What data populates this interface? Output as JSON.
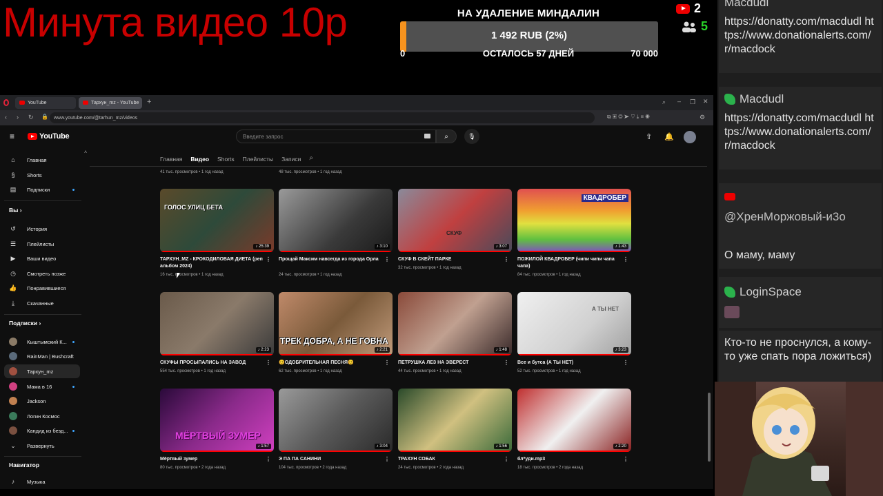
{
  "overlay": {
    "title": "Минута видео 10р",
    "goal": {
      "title": "НА УДАЛЕНИЕ МИНДАЛИН",
      "amount": "1 492 RUB (2%)",
      "progress": 0.02,
      "min": "0",
      "days_left": "ОСТАЛОСЬ 57 ДНЕЙ",
      "max": "70 000",
      "fill_color": "#f7931e"
    },
    "youtube_count": "2",
    "viewer_count": "5"
  },
  "chat": {
    "messages": [
      {
        "user": "Macdudl",
        "platform": "green-icon",
        "text": "https://donatty.com/macdudl https://www.donationalerts.com/r/macdock"
      },
      {
        "user": "Macdudl",
        "platform": "green-icon",
        "text": "https://donatty.com/macdudl https://www.donationalerts.com/r/macdock"
      },
      {
        "user": "@ХренМоржовый-и3о",
        "platform": "youtube-icon",
        "text": "О маму, маму"
      },
      {
        "user": "LoginSpace",
        "platform": "green-icon",
        "text": ""
      },
      {
        "user": "",
        "platform": "",
        "text": "Кто-то не проснулся, а кому-то уже спать пора ложиться)"
      }
    ]
  },
  "browser": {
    "tabs": [
      "YouTube",
      "Тархун_mz - YouTube"
    ],
    "url": "www.youtube.com/@tarhun_mz/videos"
  },
  "youtube": {
    "logo": "YouTube",
    "search_placeholder": "Введите запрос",
    "sidebar": {
      "main": [
        "Главная",
        "Shorts",
        "Подписки"
      ],
      "you_header": "Вы",
      "you": [
        "История",
        "Плейлисты",
        "Ваши видео",
        "Смотреть позже",
        "Понравившиеся",
        "Скачанные"
      ],
      "subs_header": "Подписки",
      "subs": [
        "Кыштымский К...",
        "RainMan | Bushcraft",
        "Тархун_mz",
        "Мама в 16",
        "Jackson",
        "Логин Космос",
        "Кандид из безд...",
        "Развернуть"
      ],
      "nav_header": "Навигатор",
      "nav": [
        "Музыка"
      ]
    },
    "channel_tabs": [
      "Главная",
      "Видео",
      "Shorts",
      "Плейлисты",
      "Записи"
    ],
    "top_row_meta": [
      "41 тыс. просмотров • 1 год назад",
      "48 тыс. просмотров • 1 год назад",
      "",
      ""
    ],
    "videos": [
      {
        "title": "ТАРХУН_MZ - КРОКОДИЛОВАЯ ДИЕТА (реп альбом 2024)",
        "meta": "16 тыс. просмотров • 1 год назад",
        "duration": "25:39",
        "overlay": "ГОЛОС УЛИЦ БЕТА"
      },
      {
        "title": "Прощай Максим навсегда из города Орла",
        "meta": "24 тыс. просмотров • 1 год назад",
        "duration": "3:10",
        "overlay": ""
      },
      {
        "title": "СКУФ В СКЕЙТ ПАРКЕ",
        "meta": "32 тыс. просмотров • 1 год назад",
        "duration": "3:07",
        "overlay": "СКУФ"
      },
      {
        "title": "ПОЖИЛОЙ КВАДРОБЕР (чипи чипи чапа чапа)",
        "meta": "84 тыс. просмотров • 1 год назад",
        "duration": "1:43",
        "overlay": "КВАДРОБЕР"
      },
      {
        "title": "СКУФЫ ПРОСЫПАЛИСЬ НА ЗАВОД",
        "meta": "554 тыс. просмотров • 1 год назад",
        "duration": "2:23",
        "overlay": ""
      },
      {
        "title": "😊ОДОБРИТЕЛЬНАЯ ПЕСНЯ😊",
        "meta": "62 тыс. просмотров • 1 год назад",
        "duration": "2:21",
        "overlay": "ТРЕК ДОБРА, А НЕ ГОВНА"
      },
      {
        "title": "ПЕТРУШКА ЛЕЗ НА ЭВЕРЕСТ",
        "meta": "44 тыс. просмотров • 1 год назад",
        "duration": "1:48",
        "overlay": ""
      },
      {
        "title": "Все и бутса (А ТЫ НЕТ)",
        "meta": "52 тыс. просмотров • 1 год назад",
        "duration": "3:23",
        "overlay": "А ТЫ НЕТ"
      },
      {
        "title": "Мёртвый зумер",
        "meta": "80 тыс. просмотров • 2 года назад",
        "duration": "1:57",
        "overlay": "МЁРТВЫЙ ЗУМЕР"
      },
      {
        "title": "Э ПА ПА САНИНИ",
        "meta": "104 тыс. просмотров • 2 года назад",
        "duration": "3:04",
        "overlay": ""
      },
      {
        "title": "ТРАХУН СОБАК",
        "meta": "24 тыс. просмотров • 2 года назад",
        "duration": "1:56",
        "overlay": ""
      },
      {
        "title": "бл*уди.mp3",
        "meta": "18 тыс. просмотров • 2 года назад",
        "duration": "2:20",
        "overlay": ""
      }
    ]
  }
}
